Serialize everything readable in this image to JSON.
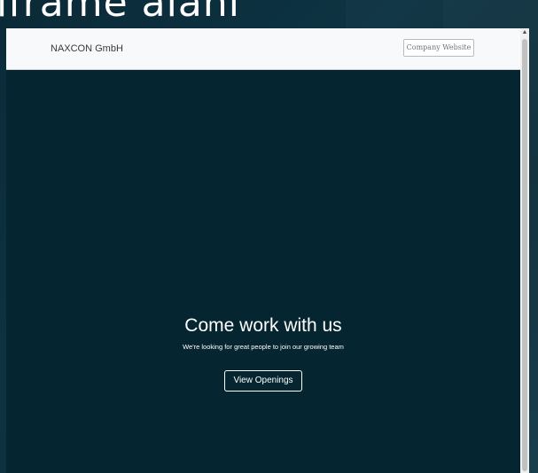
{
  "page": {
    "heading": "iframe alanı"
  },
  "iframe": {
    "header": {
      "brand": "NAXCON GmbH",
      "company_website_label": "Company Website"
    },
    "hero": {
      "title": "Come work with us",
      "subtitle": "We're looking for great people to join our growing team",
      "cta_label": "View Openings"
    },
    "scrollbar": {
      "up_arrow": "▲"
    }
  },
  "colors": {
    "page_background": "#0d3342",
    "iframe_background": "#052631",
    "header_background": "#f8f9fa",
    "text_light": "#ffffff"
  }
}
